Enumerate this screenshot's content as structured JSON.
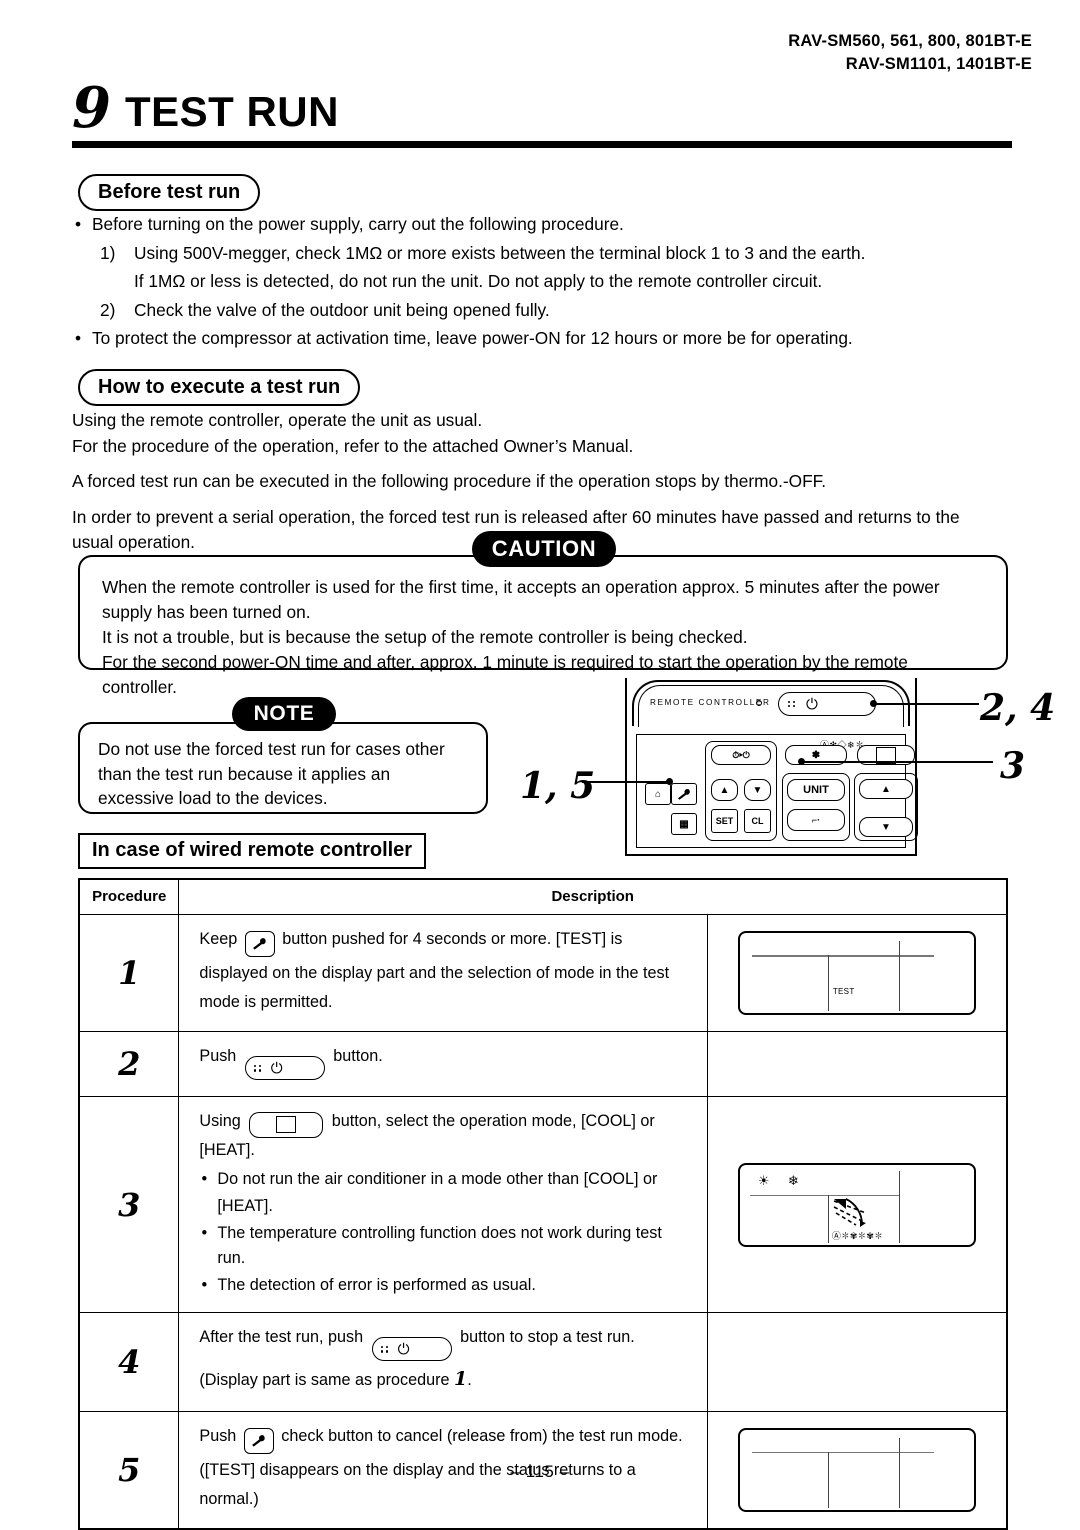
{
  "header": {
    "model_line1": "RAV-SM560, 561, 800, 801BT-E",
    "model_line2": "RAV-SM1101, 1401BT-E"
  },
  "chapter": {
    "number": "9",
    "title": "TEST RUN"
  },
  "section_before": {
    "heading": "Before test run",
    "bullet1": "Before turning on the power supply, carry out the following procedure.",
    "item1_num": "1)",
    "item1_text": "Using 500V-megger, check 1MΩ or more exists between the terminal block 1 to 3 and the earth.",
    "item1_cont": "If 1MΩ or less is detected, do not run the unit.  Do not apply to the remote controller circuit.",
    "item2_num": "2)",
    "item2_text": "Check the valve of the outdoor unit being opened fully.",
    "bullet2": "To protect the compressor at activation time, leave power-ON for 12 hours or more be for operating."
  },
  "section_howto": {
    "heading": "How to execute a test run",
    "line1": "Using the remote controller, operate the unit as usual.",
    "line2": "For the procedure of the operation, refer to the attached Owner’s Manual.",
    "line3": "A forced test run can be executed in the following procedure if the operation stops by thermo.-OFF.",
    "line4": "In order to prevent a serial operation, the forced test run is released after 60 minutes have passed and returns to the",
    "line5": "usual operation."
  },
  "caution": {
    "badge": "CAUTION",
    "line1": "When the remote controller is used for the first time, it accepts an operation approx. 5 minutes after the power",
    "line2": "supply has been turned on.",
    "line3": "It is not a trouble, but is because the setup of the remote controller is being checked.",
    "line4": "For the second power-ON time and after, approx. 1 minute is required to start the operation by the remote controller."
  },
  "note": {
    "badge": "NOTE",
    "line1": "Do not use the forced test run for cases other",
    "line2": "than the test run because it applies an",
    "line3": "excessive load to the devices."
  },
  "wired_heading": "In case of wired remote controller",
  "remote": {
    "label": "REMOTE CONTROLLER",
    "buttons": {
      "timer_onoff": "⏱▸",
      "unit": "UNIT",
      "set": "SET",
      "cl": "CL",
      "up": "▲",
      "down": "▼"
    },
    "mode_icons": "Ⓐ❇◇❄✽",
    "callouts": {
      "left": "1, 5",
      "top_right": "2, 4",
      "bottom_right": "3"
    }
  },
  "table": {
    "header": {
      "procedure": "Procedure",
      "description": "Description"
    },
    "rows": [
      {
        "step": "1",
        "lines": [
          "Keep  [wrench]  button pushed for 4 seconds or more.  [TEST] is",
          "displayed on the display part and the selection of mode in the test",
          "mode is permitted."
        ],
        "display": "test"
      },
      {
        "step": "2",
        "lines": [
          "Push  [onoff]  button."
        ],
        "display": "none"
      },
      {
        "step": "3",
        "lines": [
          "Using  [mode]  button, select the operation mode, [COOL] or [HEAT].",
          "Do not run the air conditioner in a mode other than [COOL] or",
          "[HEAT].",
          "The temperature controlling function does not work during test run.",
          "The detection of error is performed as usual."
        ],
        "display": "mode"
      },
      {
        "step": "4",
        "lines": [
          "After the test run, push  [onoff]  button to stop a test run.",
          "(Display part is same as procedure  1."
        ],
        "display": "none"
      },
      {
        "step": "5",
        "lines": [
          "Push  [wrench]  check button to cancel (release from) the test run mode.",
          "([TEST] disappears on the display and the status returns to a",
          "normal.)"
        ],
        "display": "blank"
      }
    ],
    "row1_text_a": "Keep",
    "row1_text_b": "button pushed for 4 seconds or more.  [TEST] is",
    "row1_text_c": "displayed on the display part and the selection of mode in the test",
    "row1_text_d": "mode is permitted.",
    "row2_text_a": "Push",
    "row2_text_b": "button.",
    "row3_text_a": "Using",
    "row3_text_b": "button, select the operation mode, [COOL] or [HEAT].",
    "row3_b1": "Do not run the air conditioner in a mode other than [COOL] or",
    "row3_b1b": "[HEAT].",
    "row3_b2": "The temperature controlling function does not work during test run.",
    "row3_b3": "The detection of error is performed as usual.",
    "row4_text_a": "After the test run, push",
    "row4_text_b": "button to stop a test run.",
    "row4_text_c": "(Display part is same as procedure",
    "row4_step_ref": "1",
    "row4_text_d": ".",
    "row5_text_a": "Push",
    "row5_text_b": "check button to cancel (release from) the test run mode.",
    "row5_text_c": "([TEST] disappears on the display and the status returns to a",
    "row5_text_d": "normal.)",
    "lcd_test_label": "TEST",
    "lcd_fan_row": "Ⓐ✽✾✽✾✽"
  },
  "page_number": "– 115 –",
  "colors": {
    "ink": "#000000",
    "paper": "#ffffff",
    "lcd_line": "#777777"
  }
}
